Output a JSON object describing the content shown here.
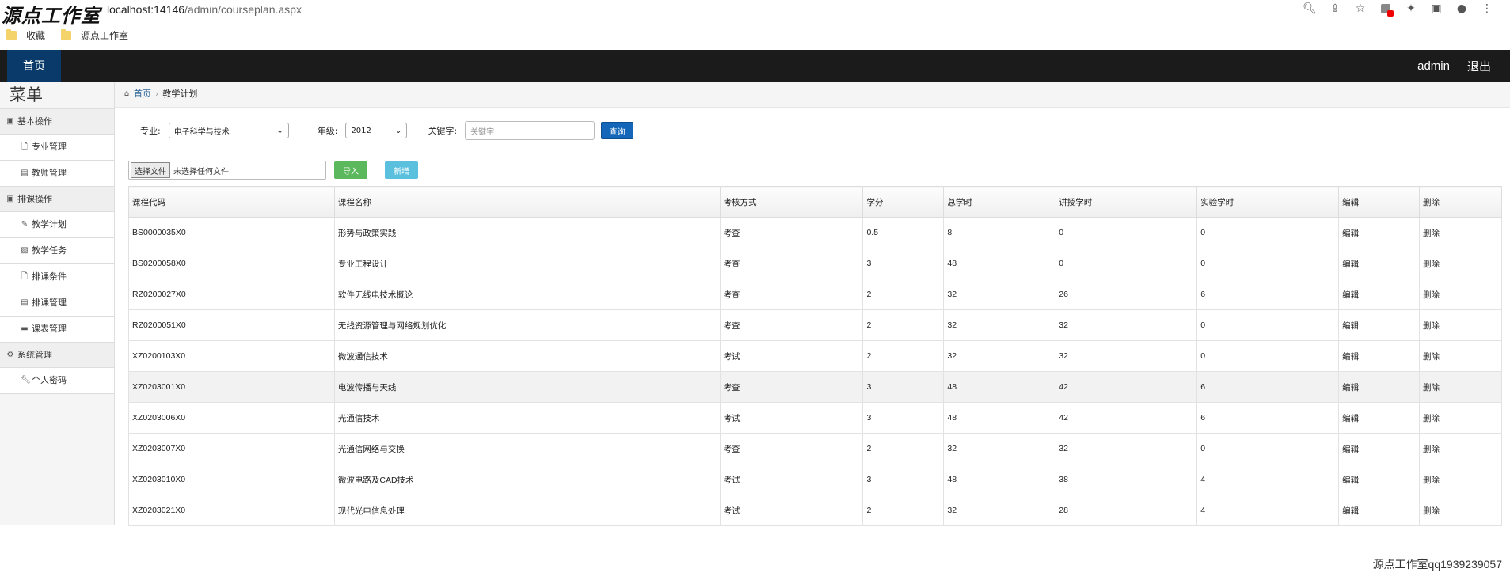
{
  "browser": {
    "brand": "源点工作室",
    "url_host": "localhost:14146",
    "url_path": "/admin/courseplan.aspx",
    "bookmarks": [
      "收藏",
      "源点工作室"
    ]
  },
  "topnav": {
    "home": "首页",
    "user": "admin",
    "logout": "退出"
  },
  "sidebar": {
    "title": "菜单",
    "sections": [
      {
        "label": "基本操作",
        "items": [
          "专业管理",
          "教师管理"
        ]
      },
      {
        "label": "排课操作",
        "items": [
          "教学计划",
          "教学任务",
          "排课条件",
          "排课管理",
          "课表管理"
        ]
      },
      {
        "label": "系统管理",
        "items": [
          "个人密码"
        ]
      }
    ]
  },
  "breadcrumb": {
    "home": "首页",
    "current": "教学计划"
  },
  "filter": {
    "major_label": "专业:",
    "major_value": "电子科学与技术",
    "grade_label": "年级:",
    "grade_value": "2012",
    "keyword_label": "关键字:",
    "keyword_placeholder": "关键字",
    "query_button": "查询"
  },
  "toolbar": {
    "choose_file": "选择文件",
    "no_file": "未选择任何文件",
    "import": "导入",
    "new": "新增"
  },
  "table": {
    "headers": [
      "课程代码",
      "课程名称",
      "考核方式",
      "学分",
      "总学时",
      "讲授学时",
      "实验学时",
      "编辑",
      "删除"
    ],
    "rows": [
      [
        "BS0000035X0",
        "形势与政策实践",
        "考查",
        "0.5",
        "8",
        "0",
        "0",
        "编辑",
        "删除"
      ],
      [
        "BS0200058X0",
        "专业工程设计",
        "考查",
        "3",
        "48",
        "0",
        "0",
        "编辑",
        "删除"
      ],
      [
        "RZ0200027X0",
        "软件无线电技术概论",
        "考查",
        "2",
        "32",
        "26",
        "6",
        "编辑",
        "删除"
      ],
      [
        "RZ0200051X0",
        "无线资源管理与网络规划优化",
        "考查",
        "2",
        "32",
        "32",
        "0",
        "编辑",
        "删除"
      ],
      [
        "XZ0200103X0",
        "微波通信技术",
        "考试",
        "2",
        "32",
        "32",
        "0",
        "编辑",
        "删除"
      ],
      [
        "XZ0203001X0",
        "电波传播与天线",
        "考查",
        "3",
        "48",
        "42",
        "6",
        "编辑",
        "删除"
      ],
      [
        "XZ0203006X0",
        "光通信技术",
        "考试",
        "3",
        "48",
        "42",
        "6",
        "编辑",
        "删除"
      ],
      [
        "XZ0203007X0",
        "光通信网络与交换",
        "考查",
        "2",
        "32",
        "32",
        "0",
        "编辑",
        "删除"
      ],
      [
        "XZ0203010X0",
        "微波电路及CAD技术",
        "考试",
        "3",
        "48",
        "38",
        "4",
        "编辑",
        "删除"
      ],
      [
        "XZ0203021X0",
        "现代光电信息处理",
        "考试",
        "2",
        "32",
        "28",
        "4",
        "编辑",
        "删除"
      ]
    ]
  },
  "footer": "源点工作室qq1939239057"
}
